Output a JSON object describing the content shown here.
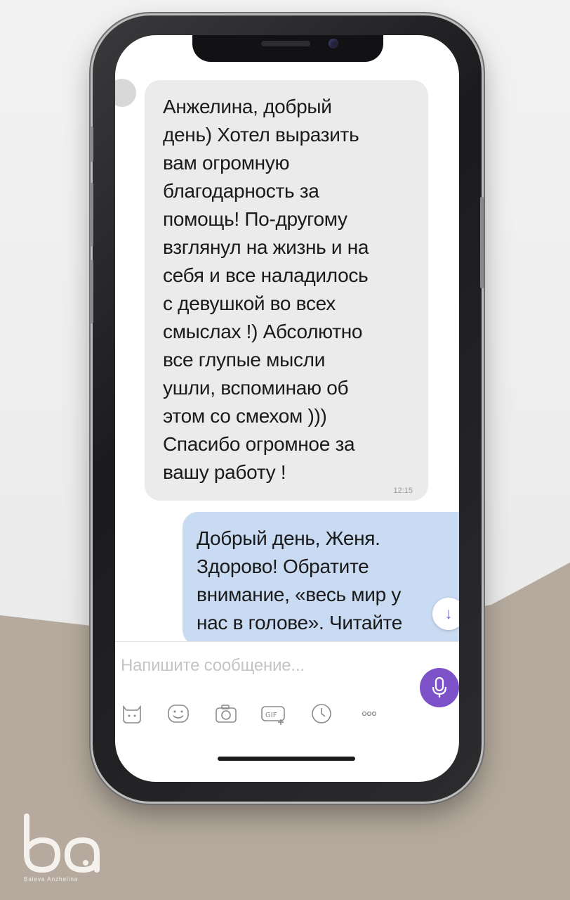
{
  "chat": {
    "incoming_message": "Анжелина, добрый\nдень) Хотел выразить\nвам огромную\nблагодарность за\nпомощь! По-другому\nвзглянул на жизнь и на\nсебя и все наладилось\nс девушкой во всех\nсмыслах !) Абсолютно\nвсе глупые мысли\nушли, вспоминаю об\nэтом со смехом )))\nСпасибо огромное за\nвашу работу !",
    "incoming_time": "12:15",
    "outgoing_message": "Добрый день, Женя.\nЗдорово! Обратите\nвнимание, «весь мир у\nнас в голове». Читайте\nФрэнка Бэкхэма..."
  },
  "composer": {
    "placeholder": "Напишите сообщение..."
  },
  "toolbar": {
    "icons": [
      "sticker-icon",
      "emoji-icon",
      "camera-icon",
      "gif-icon",
      "clock-icon",
      "more-icon"
    ],
    "gif_label": "GIF",
    "more_label": "ooo"
  },
  "branding": {
    "logo_letters": "ba",
    "caption": "Baleva Anzhelina"
  },
  "colors": {
    "accent": "#7d52c9",
    "incoming_bubble": "#ebebeb",
    "outgoing_bubble": "#c9dbf3",
    "background_beige": "#b5aa9d"
  }
}
